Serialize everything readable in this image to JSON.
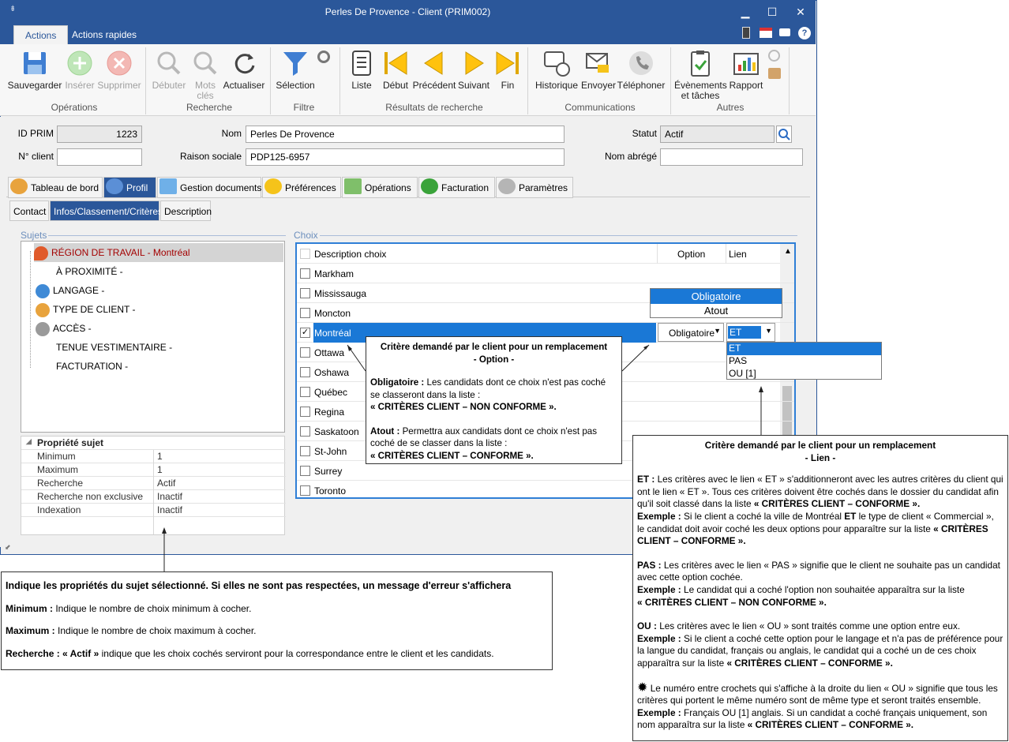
{
  "window": {
    "title": "Perles De Provence - Client (PRIM002)",
    "min": "▁",
    "max": "☐",
    "close": "✕"
  },
  "ribbon_tabs": [
    "Actions",
    "Actions rapides"
  ],
  "ribbon": {
    "sauvegarder": "Sauvegarder",
    "inserer": "Insérer",
    "supprimer": "Supprimer",
    "debuter": "Débuter",
    "mots_cles_1": "Mots",
    "mots_cles_2": "clés",
    "actualiser": "Actualiser",
    "selection": "Sélection",
    "liste": "Liste",
    "debut": "Début",
    "precedent": "Précédent",
    "suivant": "Suivant",
    "fin": "Fin",
    "historique": "Historique",
    "envoyer": "Envoyer",
    "telephoner": "Téléphoner",
    "evenements_1": "Évènements",
    "evenements_2": "et tâches",
    "rapport": "Rapport",
    "groups": [
      "Opérations",
      "Recherche",
      "Filtre",
      "Résultats de recherche",
      "Communications",
      "Autres"
    ]
  },
  "form": {
    "id_prim_label": "ID PRIM",
    "id_prim_value": "1223",
    "nom_label": "Nom",
    "nom_value": "Perles De Provence",
    "statut_label": "Statut",
    "statut_value": "Actif",
    "no_client_label": "N° client",
    "no_client_value": "",
    "raison_label": "Raison sociale",
    "raison_value": "PDP125-6957",
    "nom_abrege_label": "Nom abrégé",
    "nom_abrege_value": ""
  },
  "main_tabs": [
    "Tableau de bord",
    "Profil",
    "Gestion documents",
    "Préférences",
    "Opérations",
    "Facturation",
    "Paramètres"
  ],
  "sub_tabs": [
    "Contact",
    "Infos/Classement/Critères",
    "Description"
  ],
  "sujets": {
    "title": "Sujets",
    "items": [
      "RÉGION DE TRAVAIL - Montréal",
      "À PROXIMITÉ -",
      "LANGAGE -",
      "TYPE DE CLIENT -",
      "ACCÈS -",
      "TENUE VESTIMENTAIRE -",
      "FACTURATION -"
    ]
  },
  "propriete": {
    "title": "Propriété sujet",
    "rows": [
      [
        "Minimum",
        "1"
      ],
      [
        "Maximum",
        "1"
      ],
      [
        "Recherche",
        "Actif"
      ],
      [
        "Recherche non exclusive",
        "Inactif"
      ],
      [
        "Indexation",
        "Inactif"
      ]
    ]
  },
  "choix": {
    "title": "Choix",
    "headers": [
      "Description choix",
      "Option",
      "Lien"
    ],
    "rows": [
      "Markham",
      "Mississauga",
      "Moncton",
      "Montréal",
      "Ottawa",
      "Oshawa",
      "Québec",
      "Regina",
      "Saskatoon",
      "St-John",
      "Surrey",
      "Toronto"
    ],
    "selected_option": "Obligatoire",
    "selected_lien": "ET"
  },
  "option_dropdown": [
    "Obligatoire",
    "Atout"
  ],
  "lien_dropdown": [
    "ET",
    "PAS",
    "OU [1]"
  ],
  "callout_option": {
    "t1": "Critère demandé par le client pour un remplacement",
    "t2": "- Option -",
    "b1": "Obligatoire :",
    "p1": "Les candidats dont ce choix n'est pas coché se classeront dans la liste :",
    "q1": "« CRITÈRES CLIENT – NON CONFORME ».",
    "b2": "Atout :",
    "p2": "Permettra aux candidats dont ce choix n'est pas coché de se classer dans la liste :",
    "q2": "« CRITÈRES CLIENT – CONFORME »."
  },
  "callout_props": {
    "t": "Indique les propriétés du sujet sélectionné. Si elles ne sont pas respectées, un message d'erreur s'affichera",
    "b1": "Minimum :",
    "p1": "Indique le nombre de choix minimum à cocher.",
    "b2": "Maximum :",
    "p2": "Indique le nombre de choix maximum à cocher.",
    "b3": "Recherche : « Actif »",
    "p3": "indique que les choix cochés serviront pour la correspondance entre le client et les candidats."
  },
  "callout_lien": {
    "t1": "Critère demandé par le client pour un remplacement",
    "t2": "- Lien -",
    "et_b": "ET :",
    "et_p": "Les critères avec le lien « ET » s'additionneront avec les autres critères du client qui ont le lien « ET ». Tous ces critères doivent être cochés dans le dossier du candidat afin qu'il soit classé dans la liste",
    "et_q": "« CRITÈRES CLIENT – CONFORME ».",
    "ex1_b": "Exemple :",
    "ex1_p1": "Si le client a coché la ville de Montréal",
    "ex1_et": "ET",
    "ex1_p2": "le type de client « Commercial », le candidat doit avoir coché les deux options pour apparaître sur la liste",
    "ex1_q": "« CRITÈRES CLIENT – CONFORME ».",
    "pas_b": "PAS :",
    "pas_p": "Les critères avec le lien « PAS » signifie que le client ne souhaite pas un candidat avec cette option cochée.",
    "ex2_b": "Exemple :",
    "ex2_p": "Le candidat qui a coché l'option non souhaitée apparaîtra sur la liste",
    "ex2_q": "« CRITÈRES CLIENT – NON CONFORME ».",
    "ou_b": "OU :",
    "ou_p": "Les critères avec le lien « OU » sont traités comme une option entre eux.",
    "ex3_b": "Exemple :",
    "ex3_p": "Si le client a coché cette option pour le langage et n'a pas de préférence pour la langue du candidat, français ou anglais, le candidat qui a coché un de ces choix apparaîtra sur la liste",
    "ex3_q": "« CRITÈRES CLIENT – CONFORME ».",
    "star_p": "Le numéro entre crochets qui s'affiche à la droite du lien « OU » signifie que tous les critères qui portent le même numéro sont de même type et seront traités ensemble.",
    "ex4_b": "Exemple :",
    "ex4_p": "Français OU [1] anglais. Si un candidat a coché français uniquement, son nom apparaîtra sur la liste",
    "ex4_q": "« CRITÈRES CLIENT – CONFORME »."
  }
}
